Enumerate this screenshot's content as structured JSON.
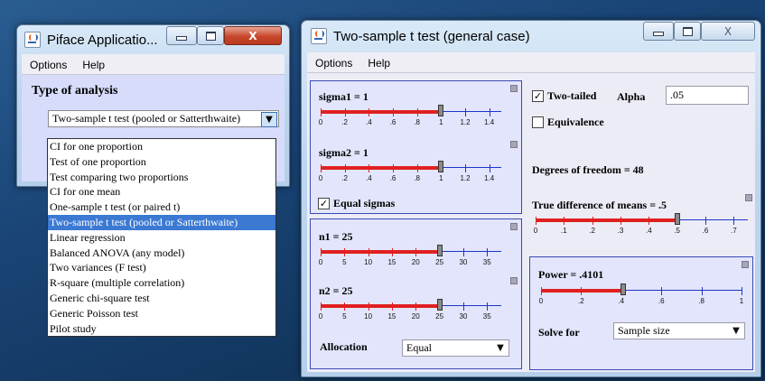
{
  "window1": {
    "title": "Piface Applicatio...",
    "menu": [
      "Options",
      "Help"
    ],
    "panel_title": "Type of analysis",
    "combo_value": "Two-sample t test (pooled or Satterthwaite)",
    "options": [
      "CI for one proportion",
      "Test of one proportion",
      "Test comparing two proportions",
      "CI for one mean",
      "One-sample t test (or paired t)",
      "Two-sample t test (pooled or Satterthwaite)",
      "Linear regression",
      "Balanced ANOVA (any model)",
      "Two variances (F test)",
      "R-square (multiple correlation)",
      "Generic chi-square test",
      "Generic Poisson test",
      "Pilot study"
    ],
    "selected_index": 5
  },
  "window2": {
    "title": "Two-sample t test (general case)",
    "menu": [
      "Options",
      "Help"
    ],
    "sigma1": {
      "label": "sigma1 = 1",
      "value": 1,
      "min": 0,
      "max": 1.5,
      "ticks": [
        "0",
        ".2",
        ".4",
        ".6",
        ".8",
        "1",
        "1.2",
        "1.4"
      ],
      "tick_values": [
        0,
        0.2,
        0.4,
        0.6,
        0.8,
        1,
        1.2,
        1.4
      ]
    },
    "sigma2": {
      "label": "sigma2 = 1",
      "value": 1,
      "min": 0,
      "max": 1.5,
      "ticks": [
        "0",
        ".2",
        ".4",
        ".6",
        ".8",
        "1",
        "1.2",
        "1.4"
      ],
      "tick_values": [
        0,
        0.2,
        0.4,
        0.6,
        0.8,
        1,
        1.2,
        1.4
      ]
    },
    "equal_sigmas": {
      "label": "Equal sigmas",
      "checked": true
    },
    "n1": {
      "label": "n1 = 25",
      "value": 25,
      "min": 0,
      "max": 38,
      "ticks": [
        "0",
        "5",
        "10",
        "15",
        "20",
        "25",
        "30",
        "35"
      ],
      "tick_values": [
        0,
        5,
        10,
        15,
        20,
        25,
        30,
        35
      ]
    },
    "n2": {
      "label": "n2 = 25",
      "value": 25,
      "min": 0,
      "max": 38,
      "ticks": [
        "0",
        "5",
        "10",
        "15",
        "20",
        "25",
        "30",
        "35"
      ],
      "tick_values": [
        0,
        5,
        10,
        15,
        20,
        25,
        30,
        35
      ]
    },
    "allocation": {
      "label": "Allocation",
      "value": "Equal"
    },
    "two_tailed": {
      "label": "Two-tailed",
      "checked": true
    },
    "alpha": {
      "label": "Alpha",
      "value": ".05"
    },
    "equivalence": {
      "label": "Equivalence",
      "checked": false
    },
    "dof": "Degrees of freedom = 48",
    "true_diff": {
      "label": "True difference of means = .5",
      "value": 0.5,
      "min": 0,
      "max": 0.75,
      "ticks": [
        "0",
        ".1",
        ".2",
        ".3",
        ".4",
        ".5",
        ".6",
        ".7"
      ],
      "tick_values": [
        0,
        0.1,
        0.2,
        0.3,
        0.4,
        0.5,
        0.6,
        0.7
      ]
    },
    "power": {
      "label": "Power = .4101",
      "value": 0.4101,
      "min": 0,
      "max": 1,
      "ticks": [
        "0",
        ".2",
        ".4",
        ".6",
        ".8",
        "1"
      ],
      "tick_values": [
        0,
        0.2,
        0.4,
        0.6,
        0.8,
        1
      ]
    },
    "solve_for": {
      "label": "Solve for",
      "value": "Sample size"
    }
  },
  "colors": {
    "desktop": "#17416f",
    "slider_fill": "#e02020",
    "slider_track": "#1f35c9",
    "selection": "#3b79d3"
  }
}
